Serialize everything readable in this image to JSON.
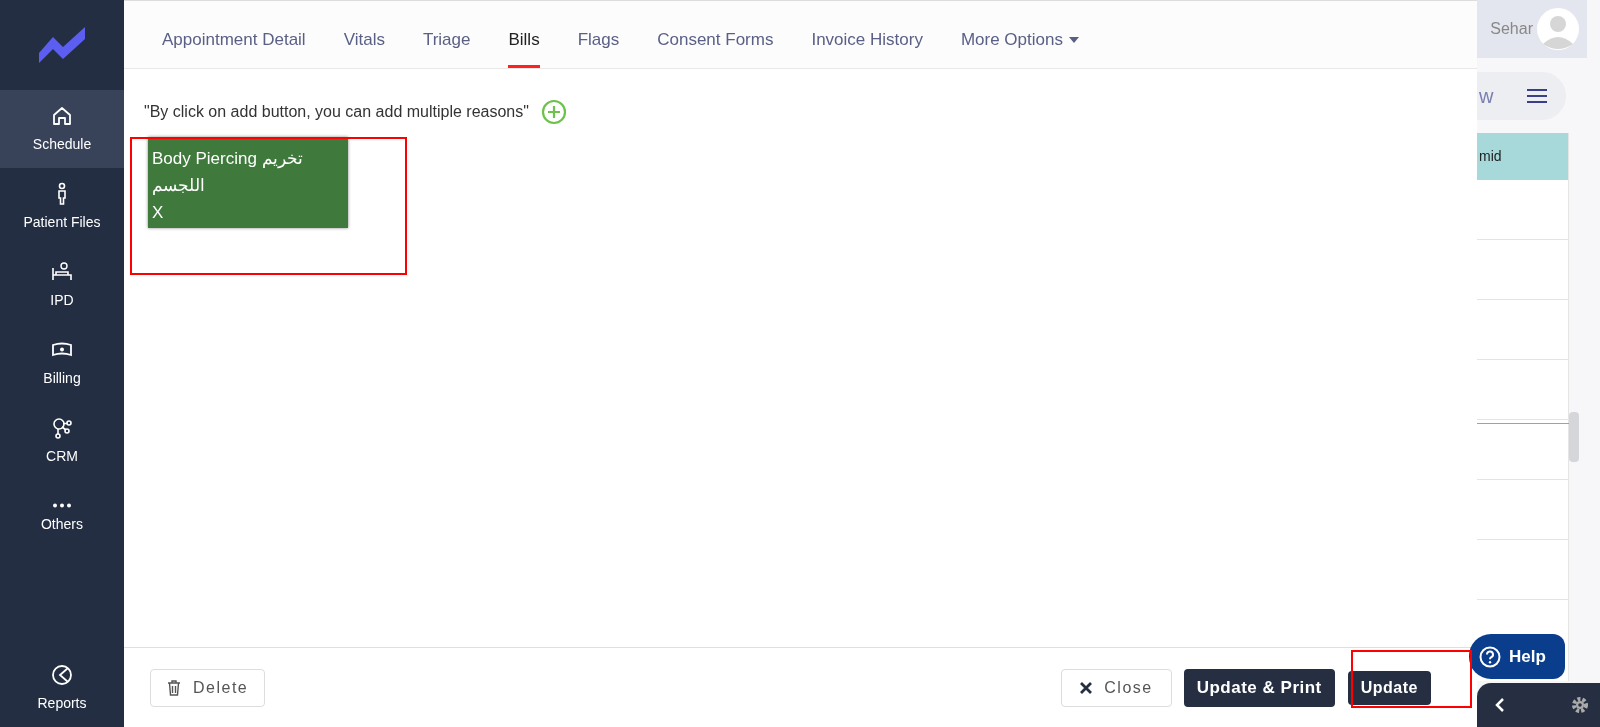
{
  "sidebar": {
    "items": [
      {
        "label": "Schedule",
        "kind": "home",
        "selected": true
      },
      {
        "label": "Patient Files",
        "kind": "person",
        "selected": false
      },
      {
        "label": "IPD",
        "kind": "bed",
        "selected": false
      },
      {
        "label": "Billing",
        "kind": "money",
        "selected": false
      },
      {
        "label": "CRM",
        "kind": "nodes",
        "selected": false
      },
      {
        "label": "Others",
        "kind": "dots",
        "selected": false
      }
    ],
    "bottom_item": {
      "label": "Reports",
      "kind": "pie"
    }
  },
  "tabs": [
    {
      "label": "Appointment Detail",
      "kind": "tab",
      "selected": false
    },
    {
      "label": "Vitals",
      "kind": "tab",
      "selected": false
    },
    {
      "label": "Triage",
      "kind": "tab",
      "selected": false
    },
    {
      "label": "Bills",
      "kind": "tab",
      "selected": true
    },
    {
      "label": "Flags",
      "kind": "tab",
      "selected": false
    },
    {
      "label": "Consent Forms",
      "kind": "tab",
      "selected": false
    },
    {
      "label": "Invoice History",
      "kind": "tab",
      "selected": false
    },
    {
      "label": "More Options",
      "kind": "dropdown",
      "selected": false
    }
  ],
  "hint": "\"By click on add button, you can add multiple reasons\"",
  "reasons": [
    {
      "label": "Body Piercing تخريم اللجسم",
      "remove": "X"
    }
  ],
  "footer": {
    "delete": "Delete",
    "close": "Close",
    "update_print": "Update & Print",
    "update": "Update"
  },
  "background": {
    "user_name": "Sehar",
    "view_label": "w",
    "column_header": "mid",
    "help": "Help"
  }
}
